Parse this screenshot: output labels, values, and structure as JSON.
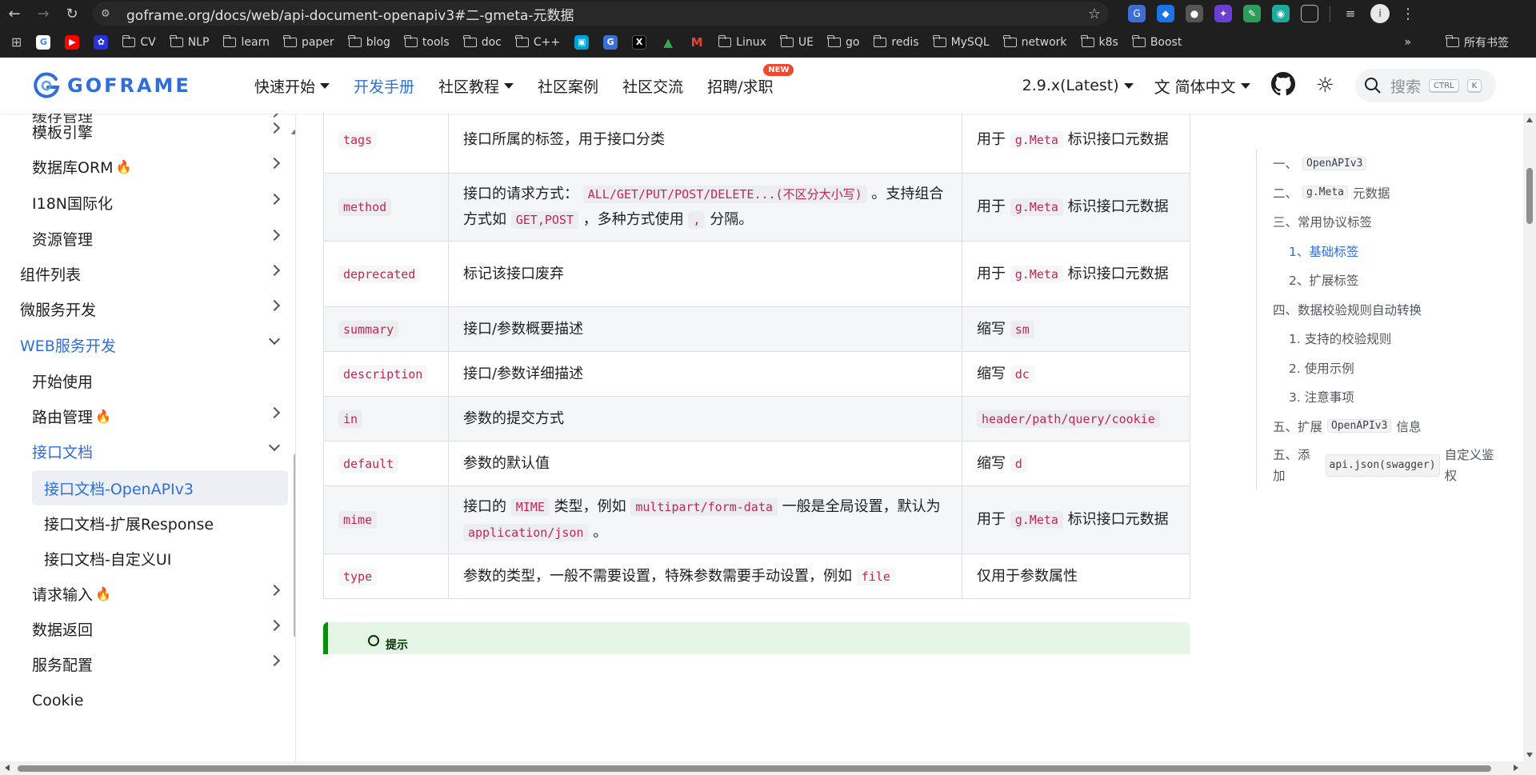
{
  "browser": {
    "url": "goframe.org/docs/web/api-document-openapiv3#二-gmeta-元数据",
    "bookmarks": [
      "CV",
      "NLP",
      "learn",
      "paper",
      "blog",
      "tools",
      "doc",
      "C++",
      "Linux",
      "UE",
      "go",
      "redis",
      "MySQL",
      "network",
      "k8s",
      "Boost"
    ],
    "all_bookmarks_label": "所有书签",
    "more_label": "»"
  },
  "site": {
    "logo_text": "GOFRAME",
    "nav": [
      {
        "label": "快速开始",
        "dropdown": true
      },
      {
        "label": "开发手册",
        "active": true
      },
      {
        "label": "社区教程",
        "dropdown": true
      },
      {
        "label": "社区案例"
      },
      {
        "label": "社区交流"
      },
      {
        "label": "招聘/求职",
        "badge": "NEW"
      }
    ],
    "version": "2.9.x(Latest)",
    "language": "简体中文",
    "search_placeholder": "搜索",
    "kbd_ctrl": "CTRL",
    "kbd_k": "K"
  },
  "sidebar": {
    "items": [
      {
        "label": "缓存管理",
        "indent": 1,
        "chevron": "right",
        "partial": true
      },
      {
        "label": "模板引擎",
        "indent": 1,
        "chevron": "right"
      },
      {
        "label": "数据库ORM",
        "indent": 1,
        "chevron": "right",
        "fire": "🔥"
      },
      {
        "label": "I18N国际化",
        "indent": 1,
        "chevron": "right"
      },
      {
        "label": "资源管理",
        "indent": 1,
        "chevron": "right"
      },
      {
        "label": "组件列表",
        "indent": 0,
        "chevron": "right"
      },
      {
        "label": "微服务开发",
        "indent": 0,
        "chevron": "right"
      },
      {
        "label": "WEB服务开发",
        "indent": 0,
        "chevron": "down",
        "blue": true
      },
      {
        "label": "开始使用",
        "indent": 1
      },
      {
        "label": "路由管理",
        "indent": 1,
        "chevron": "right",
        "fire": "🔥"
      },
      {
        "label": "接口文档",
        "indent": 1,
        "chevron": "down",
        "blue": true
      },
      {
        "label": "接口文档-OpenAPIv3",
        "indent": 2,
        "active": true
      },
      {
        "label": "接口文档-扩展Response",
        "indent": 2
      },
      {
        "label": "接口文档-自定义UI",
        "indent": 2
      },
      {
        "label": "请求输入",
        "indent": 1,
        "chevron": "right",
        "fire": "🔥"
      },
      {
        "label": "数据返回",
        "indent": 1,
        "chevron": "right"
      },
      {
        "label": "服务配置",
        "indent": 1,
        "chevron": "right"
      },
      {
        "label": "Cookie",
        "indent": 1
      }
    ]
  },
  "table": {
    "rows": [
      {
        "key": "tags",
        "desc": [
          {
            "t": "接口所属的标签，用于接口分类"
          }
        ],
        "note": [
          {
            "t": "用于 "
          },
          {
            "c": "g.Meta"
          },
          {
            "t": " 标识接口元数据"
          }
        ]
      },
      {
        "key": "method",
        "desc": [
          {
            "t": "接口的请求方式： "
          },
          {
            "c": "ALL/GET/PUT/POST/DELETE...(不区分大小写)"
          },
          {
            "t": " 。支持组合方式如 "
          },
          {
            "c": "GET,POST"
          },
          {
            "t": " ，多种方式使用 "
          },
          {
            "c": ","
          },
          {
            "t": " 分隔。"
          }
        ],
        "note": [
          {
            "t": "用于 "
          },
          {
            "c": "g.Meta"
          },
          {
            "t": " 标识接口元数据"
          }
        ]
      },
      {
        "key": "deprecated",
        "desc": [
          {
            "t": "标记该接口废弃"
          }
        ],
        "note": [
          {
            "t": "用于 "
          },
          {
            "c": "g.Meta"
          },
          {
            "t": " 标识接口元数据"
          }
        ]
      },
      {
        "key": "summary",
        "desc": [
          {
            "t": "接口/参数概要描述"
          }
        ],
        "note": [
          {
            "t": "缩写 "
          },
          {
            "c": "sm"
          }
        ]
      },
      {
        "key": "description",
        "desc": [
          {
            "t": "接口/参数详细描述"
          }
        ],
        "note": [
          {
            "t": "缩写 "
          },
          {
            "c": "dc"
          }
        ]
      },
      {
        "key": "in",
        "desc": [
          {
            "t": "参数的提交方式"
          }
        ],
        "note": [
          {
            "c": "header/path/query/cookie"
          }
        ]
      },
      {
        "key": "default",
        "desc": [
          {
            "t": "参数的默认值"
          }
        ],
        "note": [
          {
            "t": "缩写 "
          },
          {
            "c": "d"
          }
        ]
      },
      {
        "key": "mime",
        "desc": [
          {
            "t": "接口的 "
          },
          {
            "c": "MIME"
          },
          {
            "t": " 类型，例如 "
          },
          {
            "c": "multipart/form-data"
          },
          {
            "t": " 一般是全局设置，默认为 "
          },
          {
            "c": "application/json"
          },
          {
            "t": " 。"
          }
        ],
        "note": [
          {
            "t": "用于 "
          },
          {
            "c": "g.Meta"
          },
          {
            "t": " 标识接口元数据"
          }
        ]
      },
      {
        "key": "type",
        "desc": [
          {
            "t": "参数的类型，一般不需要设置，特殊参数需要手动设置，例如 "
          },
          {
            "c": "file"
          }
        ],
        "note": [
          {
            "t": "仅用于参数属性"
          }
        ]
      }
    ]
  },
  "tip": {
    "label": "提示"
  },
  "toc": {
    "items": [
      {
        "parts": [
          {
            "t": "一、 "
          },
          {
            "c": "OpenAPIv3"
          }
        ],
        "level": 0
      },
      {
        "parts": [
          {
            "t": "二、 "
          },
          {
            "c": "g.Meta"
          },
          {
            "t": " 元数据"
          }
        ],
        "level": 0
      },
      {
        "parts": [
          {
            "t": "三、常用协议标签"
          }
        ],
        "level": 0
      },
      {
        "parts": [
          {
            "t": "1、基础标签"
          }
        ],
        "level": 1,
        "active": true
      },
      {
        "parts": [
          {
            "t": "2、扩展标签"
          }
        ],
        "level": 1
      },
      {
        "parts": [
          {
            "t": "四、数据校验规则自动转换"
          }
        ],
        "level": 0
      },
      {
        "parts": [
          {
            "t": "1. 支持的校验规则"
          }
        ],
        "level": 1
      },
      {
        "parts": [
          {
            "t": "2. 使用示例"
          }
        ],
        "level": 1
      },
      {
        "parts": [
          {
            "t": "3. 注意事项"
          }
        ],
        "level": 1
      },
      {
        "parts": [
          {
            "t": "五、扩展 "
          },
          {
            "c": "OpenAPIv3"
          },
          {
            "t": " 信息"
          }
        ],
        "level": 0
      },
      {
        "parts": [
          {
            "t": "五、添加 "
          },
          {
            "c": "api.json(swagger)"
          },
          {
            "t": " 自定义鉴权"
          }
        ],
        "level": 0,
        "wrap": true
      }
    ]
  },
  "colors": {
    "accent": "#2f6fdc",
    "code_text": "#c7254e",
    "tip_border": "#009400"
  }
}
